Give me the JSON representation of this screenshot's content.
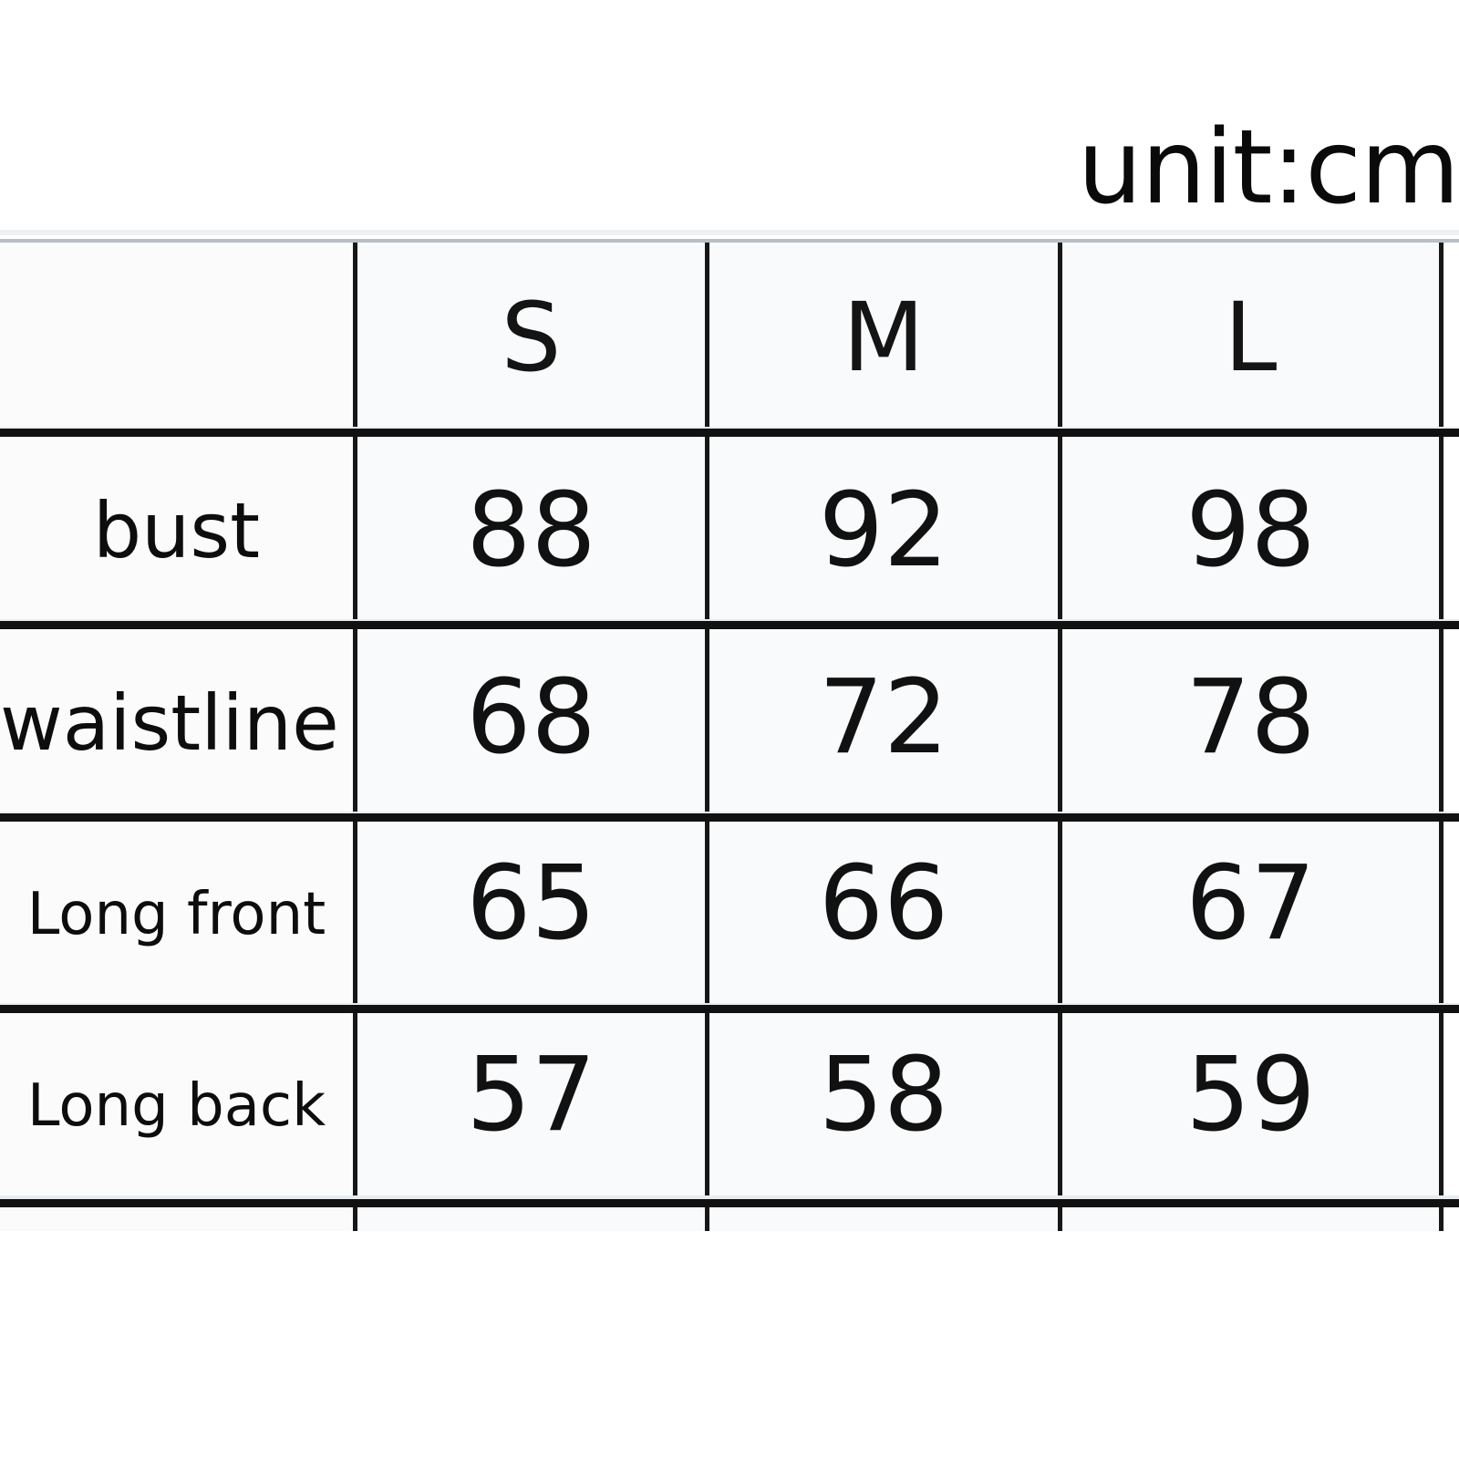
{
  "unit": {
    "text": "unit:cm"
  },
  "colors": {
    "rule": "#111111",
    "text": "#0d0d0d",
    "cell_background": "#f9fafb",
    "top_hairline": "#b9bfc4"
  },
  "chart_data": {
    "type": "table",
    "title": "unit:cm",
    "columns": [
      "",
      "S",
      "M",
      "L"
    ],
    "rows": [
      {
        "label": "bust",
        "values": [
          "88",
          "92",
          "98"
        ]
      },
      {
        "label": "waistline",
        "values": [
          "68",
          "72",
          "78"
        ]
      },
      {
        "label": "Long front",
        "values": [
          "65",
          "66",
          "67"
        ]
      },
      {
        "label": "Long back",
        "values": [
          "57",
          "58",
          "59"
        ]
      }
    ],
    "unit": "cm",
    "notes": "Garment size chart; sizes S/M/L across columns, measurements in centimeters. A further row is cut off at the bottom edge."
  }
}
